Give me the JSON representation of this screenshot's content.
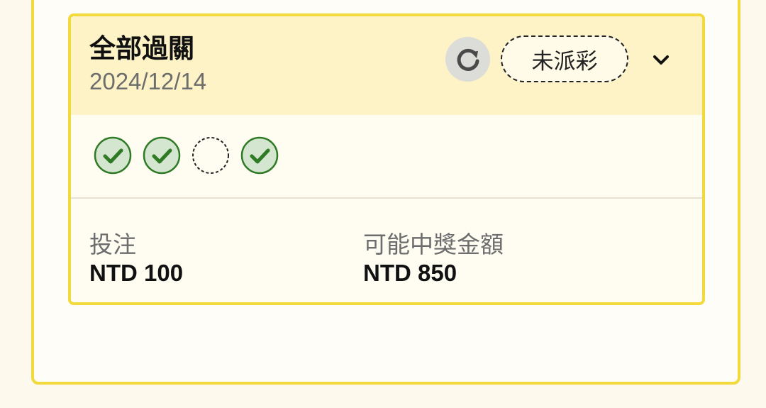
{
  "bet": {
    "type": "全部過關",
    "date": "2024/12/14",
    "status": "未派彩",
    "legs": [
      {
        "result": "won",
        "icon": "check-circle-icon"
      },
      {
        "result": "won",
        "icon": "check-circle-icon"
      },
      {
        "result": "pending",
        "icon": "dashed-circle-icon"
      },
      {
        "result": "won",
        "icon": "check-circle-icon"
      }
    ],
    "stake": {
      "label": "投注",
      "value": "NTD 100"
    },
    "potential_payout": {
      "label": "可能中獎金額",
      "value": "NTD 850"
    }
  },
  "colors": {
    "border": "#f2d93c",
    "header_bg": "#fdf3c6",
    "card_bg": "#fffcf2",
    "check_fill": "#d4e6cf",
    "check_stroke": "#2f7a24"
  },
  "icons": {
    "refresh": "refresh-icon",
    "expand": "chevron-down-icon"
  }
}
